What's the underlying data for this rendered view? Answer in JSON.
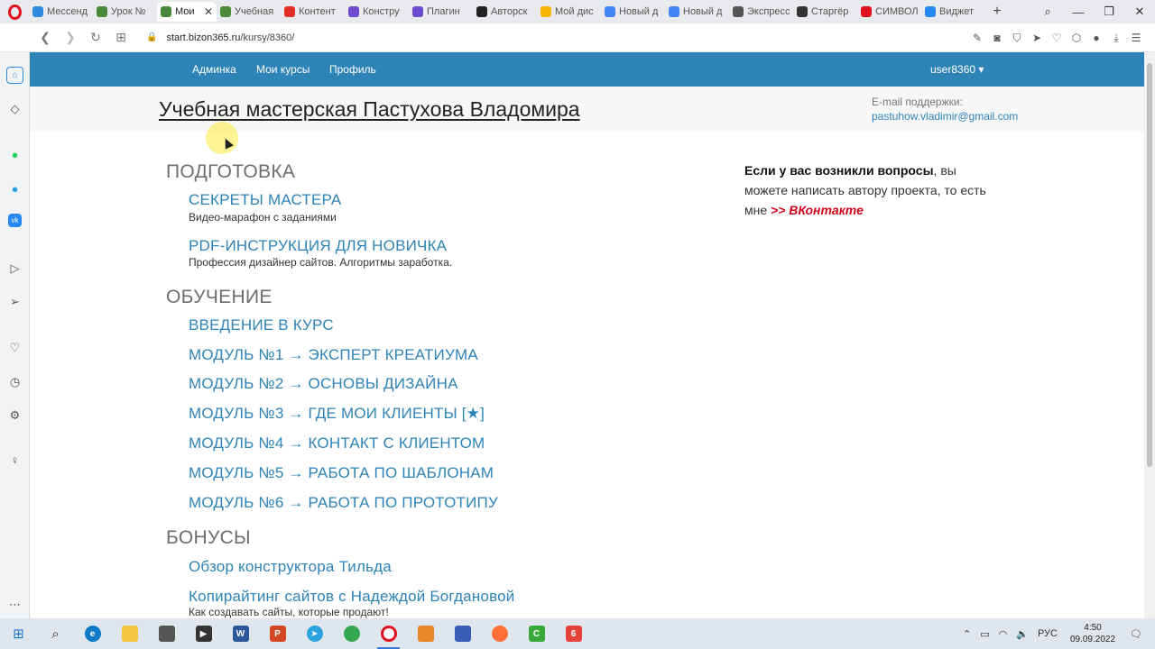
{
  "browser": {
    "tabs": [
      {
        "label": "Мессенд",
        "color": "#2d8ce0"
      },
      {
        "label": "Урок №",
        "color": "#4a8a3a"
      },
      {
        "label": "Мои",
        "color": "#4a8a3a",
        "active": true,
        "close": "✕"
      },
      {
        "label": "Учебная",
        "color": "#4a8a3a"
      },
      {
        "label": "Контент",
        "color": "#e52d27"
      },
      {
        "label": "Констру",
        "color": "#6c4bd1"
      },
      {
        "label": "Плагин",
        "color": "#6c4bd1"
      },
      {
        "label": "Авторск",
        "color": "#222222"
      },
      {
        "label": "Мой дис",
        "color": "#f4b400"
      },
      {
        "label": "Новый д",
        "color": "#4285f4"
      },
      {
        "label": "Новый д",
        "color": "#4285f4"
      },
      {
        "label": "Экспресс",
        "color": "#555555"
      },
      {
        "label": "Старгёр",
        "color": "#333333"
      },
      {
        "label": "СИМВОЛ",
        "color": "#e0101f"
      },
      {
        "label": "Виджет",
        "color": "#2787f5"
      }
    ],
    "new_tab": "+",
    "url_host": "start.bizon365.ru",
    "url_path": "/kursy/8360/",
    "lock_icon": "🔒"
  },
  "nav": {
    "links": [
      "Админка",
      "Мои курсы",
      "Профиль"
    ],
    "user": "user8360 ▾"
  },
  "header": {
    "title": "Учебная мастерская Пастухова Владомира",
    "support_label": "E-mail поддержки:",
    "support_email": "pastuhow.vladimir@gmail.com"
  },
  "sections": {
    "prep": "ПОДГОТОВКА",
    "learn": "ОБУЧЕНИЕ",
    "bonus": "БОНУСЫ"
  },
  "courses": {
    "c1": {
      "title": "СЕКРЕТЫ МАСТЕРА",
      "desc": "Видео-марафон с заданиями"
    },
    "c2": {
      "title": "PDF-ИНСТРУКЦИЯ ДЛЯ НОВИЧКА",
      "desc": "Профессия дизайнер сайтов. Алгоритмы заработка."
    },
    "m0": "ВВЕДЕНИЕ В КУРС",
    "m1": "МОДУЛЬ №1 → ЭКСПЕРТ КРЕАТИУМА",
    "m2": "МОДУЛЬ №2 → ОСНОВЫ ДИЗАЙНА",
    "m3": "МОДУЛЬ №3 → ГДЕ МОИ КЛИЕНТЫ [★]",
    "m4": "МОДУЛЬ №4 → КОНТАКТ С КЛИЕНТОМ",
    "m5": "МОДУЛЬ №5 → РАБОТА ПО ШАБЛОНАМ",
    "m6": "МОДУЛЬ №6 → РАБОТА ПО ПРОТОТИПУ",
    "b1": "Обзор конструктора Тильда",
    "b2": {
      "title": "Копирайтинг сайтов с Надеждой Богдановой",
      "desc": "Как создавать сайты, которые продают!"
    }
  },
  "side_note": {
    "bold": "Если у вас возникли вопросы",
    "rest": ", вы можете написать автору проекта, то есть мне ",
    "vk": ">> ВКонтакте"
  },
  "taskbar": {
    "lang": "РУС",
    "time": "4:50",
    "date": "09.09.2022"
  }
}
